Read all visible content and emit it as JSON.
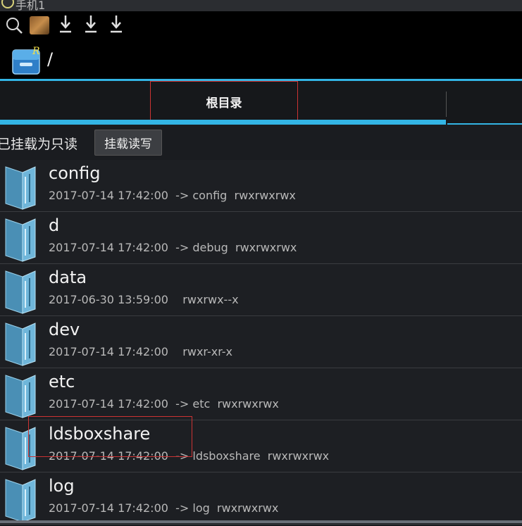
{
  "window": {
    "title": "手机1"
  },
  "statusbar": {
    "icons": [
      "search-icon",
      "game-avatar",
      "download-icon",
      "download-icon",
      "download-icon"
    ]
  },
  "appbar": {
    "path": "/"
  },
  "tabs": [
    {
      "label": "根目录",
      "selected": true
    }
  ],
  "mount": {
    "status_text": "已挂载为只读",
    "button_label": "挂载读写"
  },
  "files": [
    {
      "name": "config",
      "meta": "2017-07-14 17:42:00  -> config  rwxrwxrwx"
    },
    {
      "name": "d",
      "meta": "2017-07-14 17:42:00  -> debug  rwxrwxrwx"
    },
    {
      "name": "data",
      "meta": "2017-06-30 13:59:00    rwxrwx--x"
    },
    {
      "name": "dev",
      "meta": "2017-07-14 17:42:00    rwxr-xr-x"
    },
    {
      "name": "etc",
      "meta": "2017-07-14 17:42:00  -> etc  rwxrwxrwx"
    },
    {
      "name": "ldsboxshare",
      "meta": "2017-07-14 17:42:00  -> ldsboxshare  rwxrwxrwx"
    },
    {
      "name": "log",
      "meta": "2017-07-14 17:42:00  -> log  rwxrwxrwx"
    }
  ],
  "colors": {
    "accent": "#33b5e5",
    "highlight": "#cc3333",
    "background": "#1a1c20"
  }
}
